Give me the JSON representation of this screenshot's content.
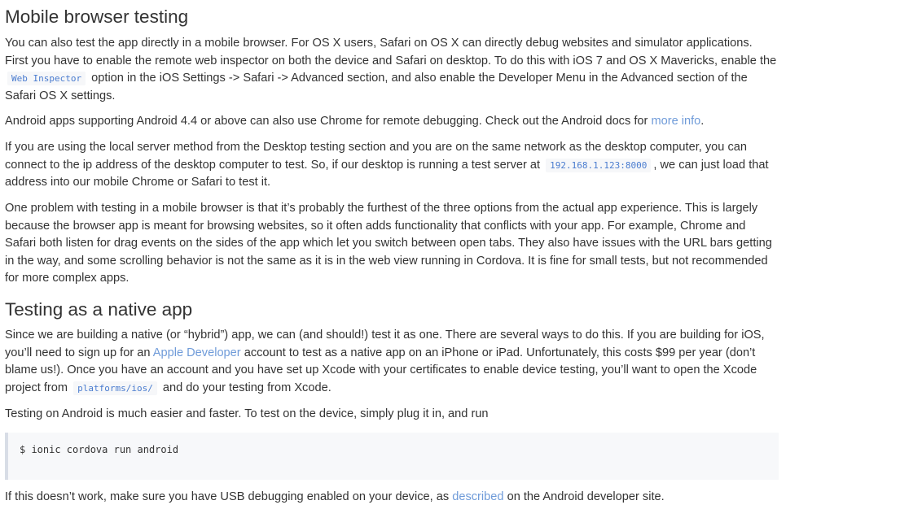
{
  "section1": {
    "heading": "Mobile browser testing",
    "p1": {
      "before": "You can also test the app directly in a mobile browser. For OS X users, Safari on OS X can directly debug websites and simulator applications. First you have to enable the remote web inspector on both the device and Safari on desktop. To do this with iOS 7 and OS X Mavericks, enable the",
      "code": "Web Inspector",
      "after": "option in the iOS Settings -> Safari -> Advanced section, and also enable the Developer Menu in the Advanced section of the Safari OS X settings."
    },
    "p2": {
      "before": "Android apps supporting Android 4.4 or above can also use Chrome for remote debugging. Check out the Android docs for",
      "link": "more info",
      "after": "."
    },
    "p3": {
      "before": "If you are using the local server method from the Desktop testing section and you are on the same network as the desktop computer, you can connect to the ip address of the desktop computer to test. So, if our desktop is running a test server at",
      "code": "192.168.1.123:8000",
      "after": ", we can just load that address into our mobile Chrome or Safari to test it."
    },
    "p4": "One problem with testing in a mobile browser is that it’s probably the furthest of the three options from the actual app experience. This is largely because the browser app is meant for browsing websites, so it often adds functionality that conflicts with your app. For example, Chrome and Safari both listen for drag events on the sides of the app which let you switch between open tabs. They also have issues with the URL bars getting in the way, and some scrolling behavior is not the same as it is in the web view running in Cordova. It is fine for small tests, but not recommended for more complex apps."
  },
  "section2": {
    "heading": "Testing as a native app",
    "p1": {
      "before": "Since we are building a native (or “hybrid”) app, we can (and should!) test it as one. There are several ways to do this. If you are building for iOS, you’ll need to sign up for an",
      "link": "Apple Developer",
      "middle": "account to test as a native app on an iPhone or iPad. Unfortunately, this costs $99 per year (don’t blame us!). Once you have an account and you have set up Xcode with your certificates to enable device testing, you’ll want to open the Xcode project from",
      "code": "platforms/ios/",
      "after": "and do your testing from Xcode."
    },
    "p2": "Testing on Android is much easier and faster. To test on the device, simply plug it in, and run",
    "command": "$ ionic cordova run android",
    "p3": {
      "before": "If this doesn’t work, make sure you have USB debugging enabled on your device, as",
      "link": "described",
      "after": "on the Android developer site."
    }
  },
  "colors": {
    "text": "#333333",
    "link": "#6f9bd9",
    "inline_code": "#4a7ccf",
    "code_bg": "#f6f7f9",
    "blockquote_border": "#d8dde6"
  }
}
